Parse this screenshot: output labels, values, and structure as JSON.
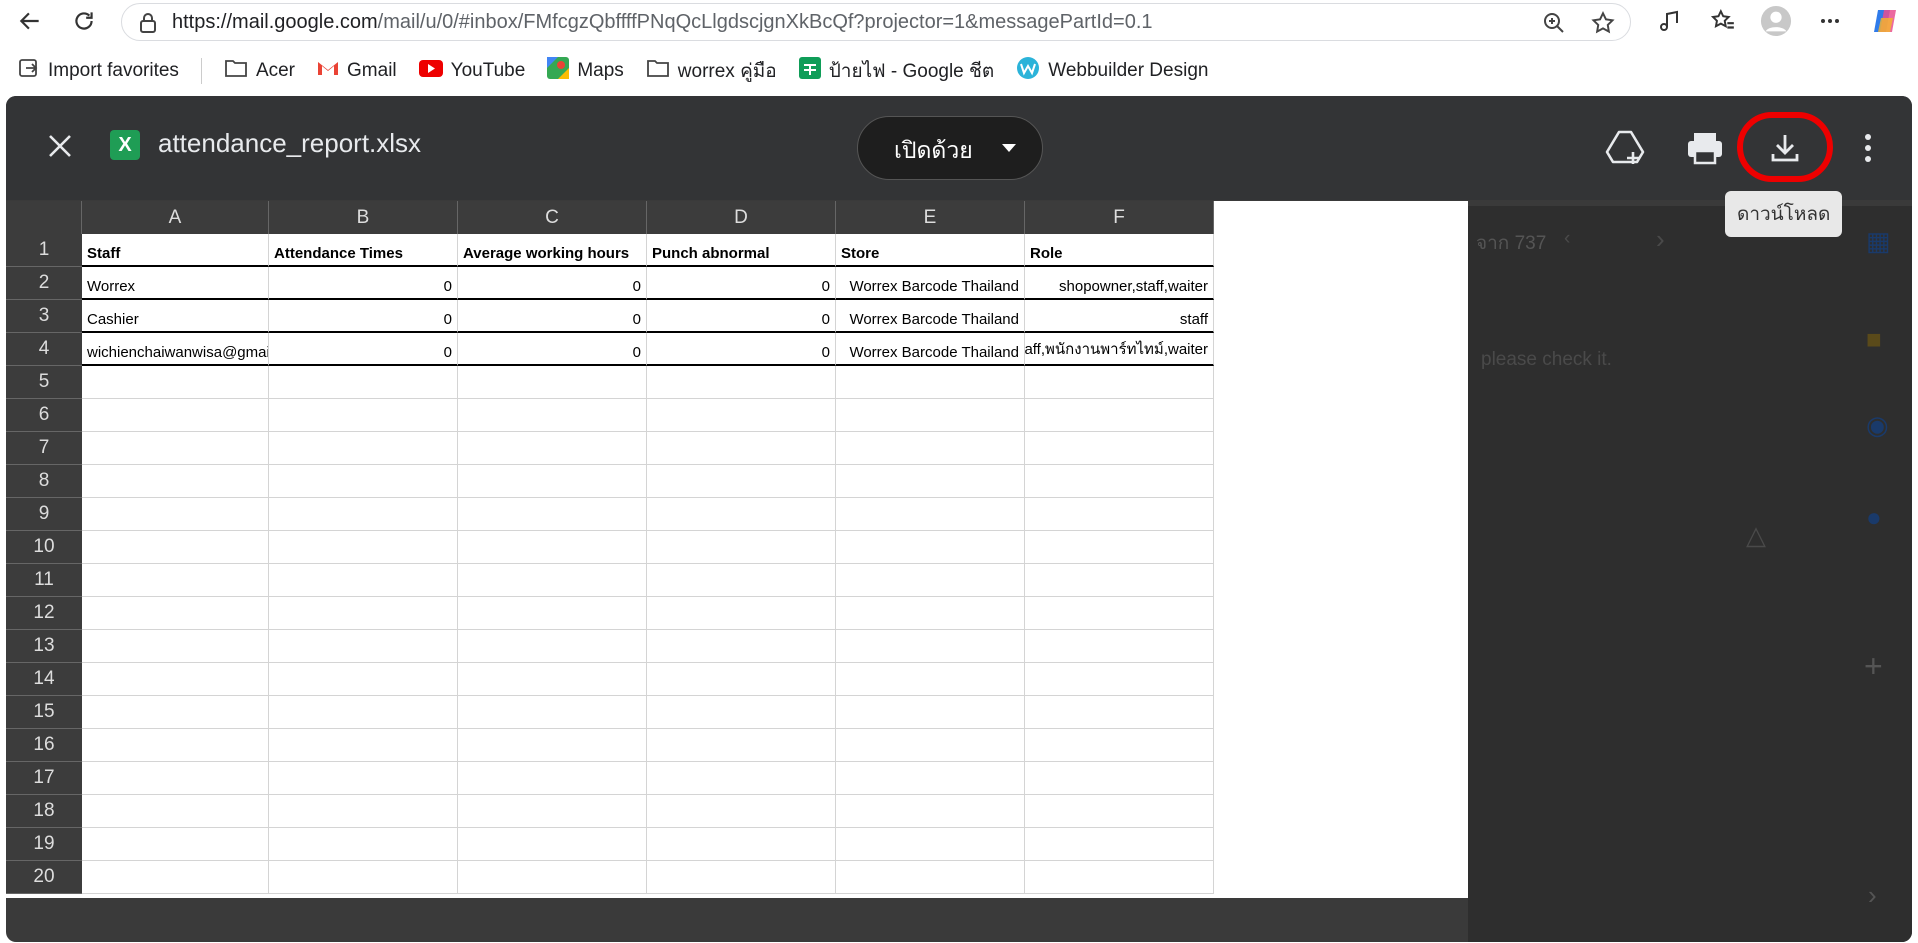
{
  "browser": {
    "url_host": "https://mail.google.com",
    "url_rest": "/mail/u/0/#inbox/FMfcgzQbffffPNqQcLlgdscjgnXkBcQf?projector=1&messagePartId=0.1"
  },
  "bookmarks": [
    {
      "label": "Import favorites",
      "icon": "import-icon"
    },
    {
      "label": "Acer",
      "icon": "folder-icon"
    },
    {
      "label": "Gmail",
      "icon": "gmail-icon"
    },
    {
      "label": "YouTube",
      "icon": "youtube-icon"
    },
    {
      "label": "Maps",
      "icon": "maps-icon"
    },
    {
      "label": "worrex คู่มือ",
      "icon": "folder-icon"
    },
    {
      "label": "ป้ายไฟ - Google ชีต",
      "icon": "sheets-icon"
    },
    {
      "label": "Webbuilder Design",
      "icon": "webbuilder-icon"
    }
  ],
  "viewer": {
    "filename": "attendance_report.xlsx",
    "file_badge": "X",
    "open_with_label": "เปิดด้วย",
    "tooltip": "ดาวน์โหลด",
    "bg_page_count": "จาก 737",
    "bg_message": "please check it."
  },
  "sheet": {
    "columns": [
      "A",
      "B",
      "C",
      "D",
      "E",
      "F"
    ],
    "rows": [
      "1",
      "2",
      "3",
      "4",
      "5",
      "6",
      "7",
      "8",
      "9",
      "10",
      "11",
      "12",
      "13",
      "14",
      "15",
      "16",
      "17",
      "18",
      "19",
      "20"
    ],
    "header": [
      "Staff",
      "Attendance Times",
      "Average working hours",
      "Punch abnormal",
      "Store",
      "Role"
    ],
    "data": [
      [
        "Worrex",
        "0",
        "0",
        "0",
        "Worrex Barcode Thailand",
        "shopowner,staff,waiter"
      ],
      [
        "Cashier",
        "0",
        "0",
        "0",
        "Worrex Barcode Thailand",
        "staff"
      ],
      [
        " wichienchaiwanwisa@gmail",
        "0",
        "0",
        "0",
        "Worrex Barcode Thailand",
        ",staff,พนักงานพาร์ทไทม์,waiter"
      ]
    ]
  },
  "colors": {
    "highlight": "#e00000",
    "excel_green": "#1f9d55"
  }
}
